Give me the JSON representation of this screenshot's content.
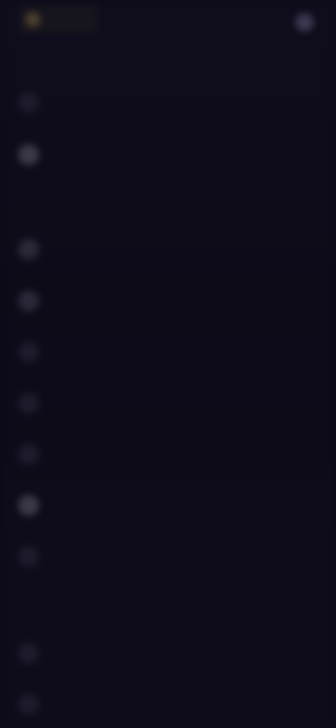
{
  "topbar": {
    "brand_label": "",
    "action_label": ""
  },
  "page": {
    "title": ""
  },
  "items_top": [
    {
      "label": ""
    },
    {
      "label": ""
    }
  ],
  "sections": [
    {
      "title": "",
      "items": [
        {
          "label": ""
        },
        {
          "label": ""
        },
        {
          "label": ""
        },
        {
          "label": ""
        },
        {
          "label": ""
        },
        {
          "label": ""
        },
        {
          "label": ""
        }
      ]
    },
    {
      "title": "",
      "items": [
        {
          "label": ""
        },
        {
          "label": ""
        }
      ]
    }
  ],
  "colors": {
    "background": "#0d0b18",
    "text_dim": "#3b3852",
    "brand_accent": "#4a3f2c"
  }
}
